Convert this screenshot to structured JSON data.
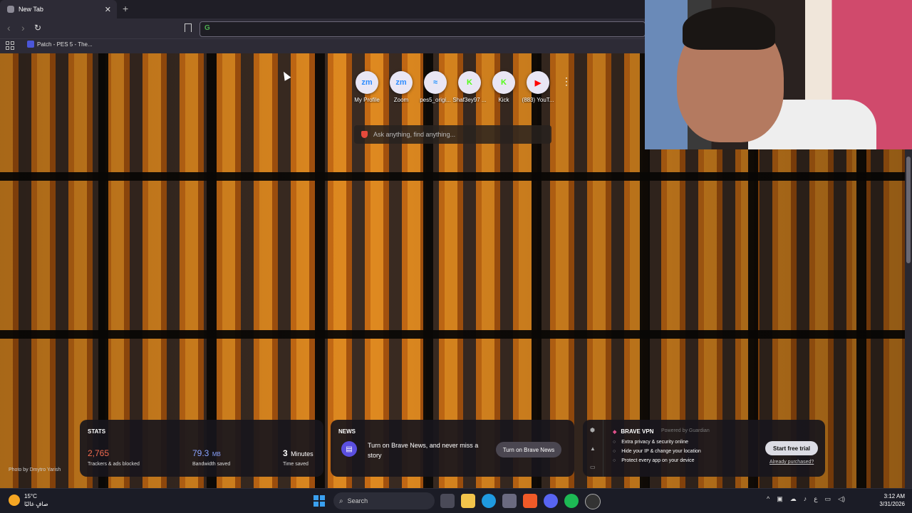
{
  "browser": {
    "tab_title": "New Tab",
    "tab_close": "✕",
    "new_tab": "+",
    "bookmark_label": "Patch - PES 5 - The..."
  },
  "top_sites": [
    {
      "label": "My Profile",
      "icon": "zm",
      "color": "#2d8cff"
    },
    {
      "label": "Zoom",
      "icon": "zm",
      "color": "#2d8cff"
    },
    {
      "label": "pes5_origi...",
      "icon": "≈",
      "color": "#1e90ff"
    },
    {
      "label": "Shaf3ey97 ...",
      "icon": "K",
      "color": "#53fc18"
    },
    {
      "label": "Kick",
      "icon": "K",
      "color": "#53fc18"
    },
    {
      "label": "(883) YouT...",
      "icon": "▶",
      "color": "#ff0000"
    }
  ],
  "search": {
    "placeholder": "Ask anything, find anything..."
  },
  "stats": {
    "title": "STATS",
    "trackers_value": "2,765",
    "trackers_label": "Trackers & ads blocked",
    "bandwidth_value": "79.3",
    "bandwidth_unit": "MB",
    "bandwidth_label": "Bandwidth saved",
    "time_value": "3",
    "time_unit": "Minutes",
    "time_label": "Time saved",
    "colors": {
      "trackers": "#f26b4f",
      "bandwidth": "#8aa3ff",
      "time": "#ffffff"
    }
  },
  "news": {
    "title": "NEWS",
    "message": "Turn on Brave News, and never miss a story",
    "button": "Turn on Brave News"
  },
  "vpn": {
    "name": "BRAVE VPN",
    "powered": "Powered by  Guardian",
    "features": [
      "Extra privacy & security online",
      "Hide your IP & change your location",
      "Protect every app on your device"
    ],
    "button": "Start free trial",
    "link": "Already purchased?"
  },
  "photo_credit": "Photo by Dmytro Yarish",
  "taskbar": {
    "weather_temp": "15°C",
    "weather_desc": "صافٍ غالبًا",
    "search_label": "Search",
    "time": "3:12 AM",
    "date": "3/31/2026",
    "lang": "ع"
  }
}
